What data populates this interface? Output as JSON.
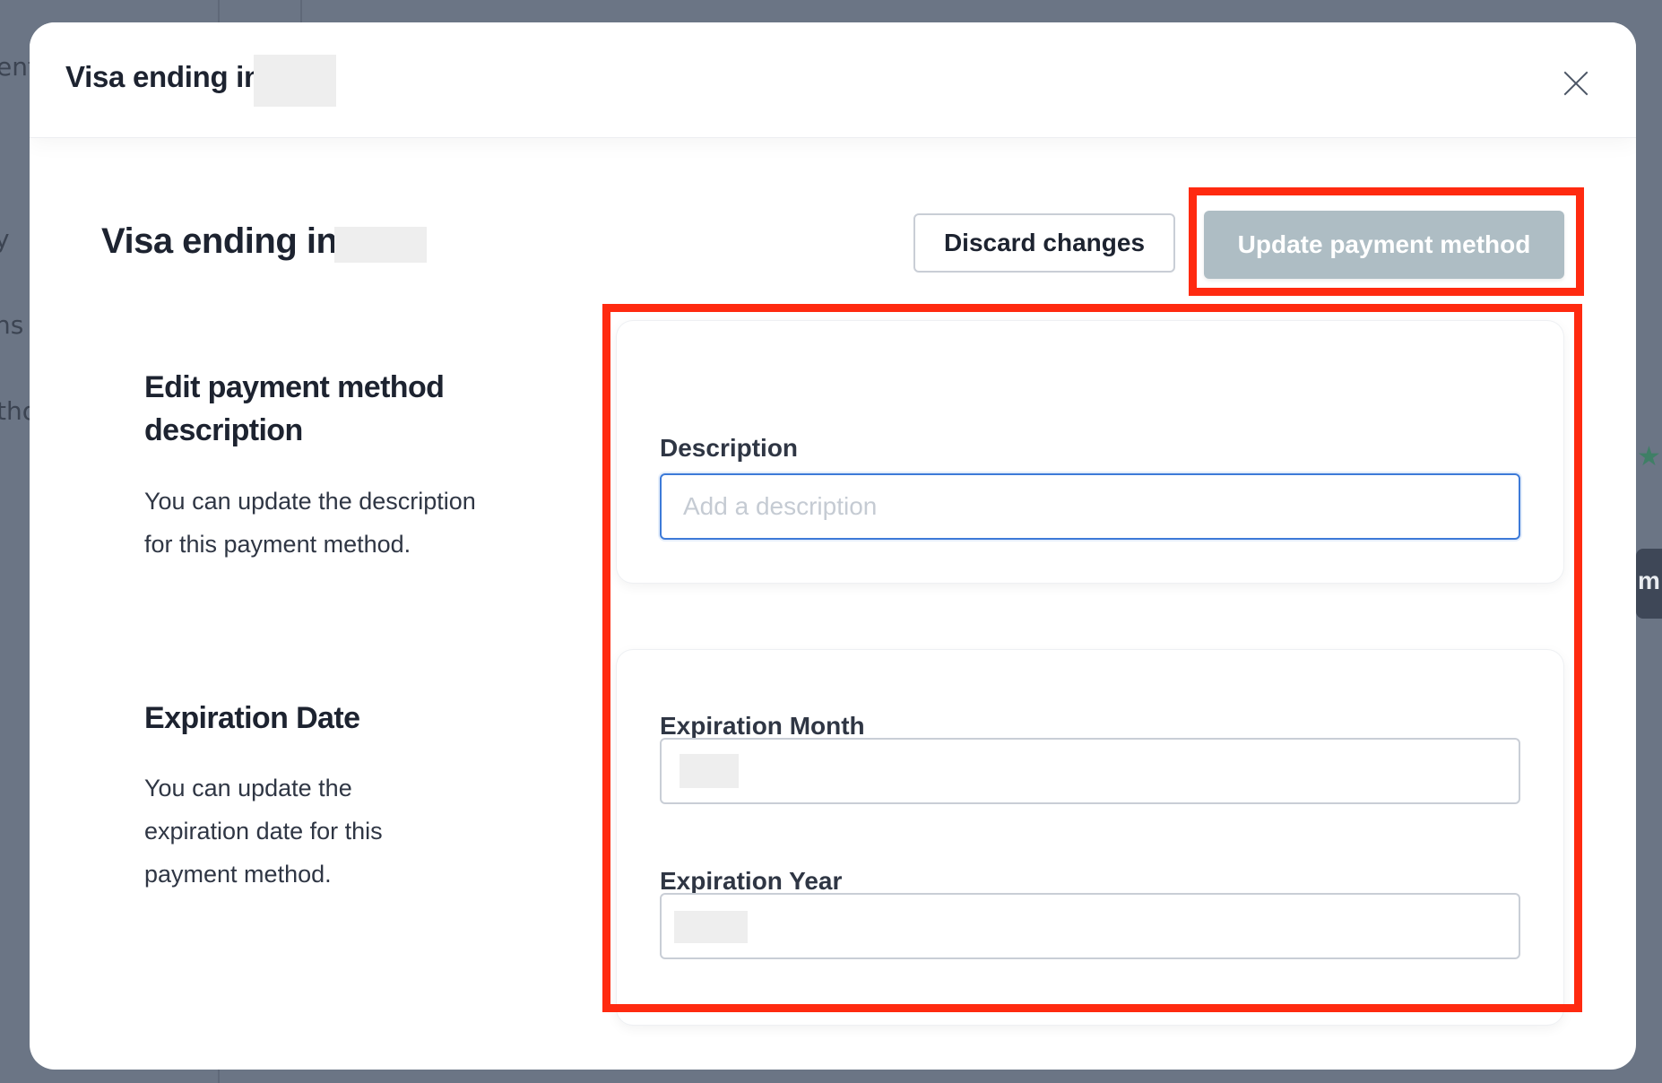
{
  "background": {
    "fragments": [
      "ent",
      "y",
      "ns",
      "tho",
      "m"
    ]
  },
  "modal": {
    "title": "Visa ending in",
    "close_icon": "close-icon"
  },
  "page": {
    "title": "Visa ending in"
  },
  "actions": {
    "discard_label": "Discard changes",
    "update_label": "Update payment method",
    "update_disabled": true
  },
  "sections": {
    "description": {
      "heading": "Edit payment method description",
      "text": "You can update the description for this payment method."
    },
    "expiration": {
      "heading": "Expiration Date",
      "text": "You can update the expiration date for this payment method."
    }
  },
  "form": {
    "description": {
      "label": "Description",
      "value": "",
      "placeholder": "Add a description"
    },
    "expiration_month": {
      "label": "Expiration Month"
    },
    "expiration_year": {
      "label": "Expiration Year"
    }
  },
  "colors": {
    "highlight": "#ff2a10",
    "update_button": "#aebdc4",
    "focus_border": "#3d7ad8"
  }
}
